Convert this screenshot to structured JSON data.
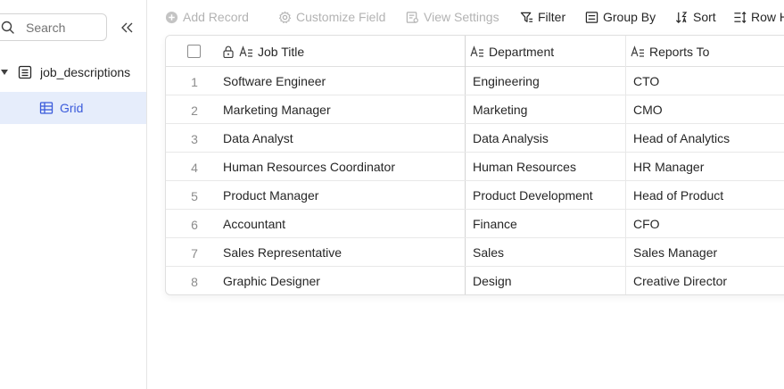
{
  "sidebar": {
    "search_placeholder": "Search",
    "table_name": "job_descriptions",
    "view_name": "Grid"
  },
  "toolbar": {
    "add_record": "Add Record",
    "customize_field": "Customize Field",
    "view_settings": "View Settings",
    "filter": "Filter",
    "group_by": "Group By",
    "sort": "Sort",
    "row_height": "Row Height"
  },
  "grid": {
    "columns": [
      "Job Title",
      "Department",
      "Reports To"
    ],
    "rows": [
      {
        "num": "1",
        "job_title": "Software Engineer",
        "department": "Engineering",
        "reports_to": "CTO"
      },
      {
        "num": "2",
        "job_title": "Marketing Manager",
        "department": "Marketing",
        "reports_to": "CMO"
      },
      {
        "num": "3",
        "job_title": "Data Analyst",
        "department": "Data Analysis",
        "reports_to": "Head of Analytics"
      },
      {
        "num": "4",
        "job_title": "Human Resources Coordinator",
        "department": "Human Resources",
        "reports_to": "HR Manager"
      },
      {
        "num": "5",
        "job_title": "Product Manager",
        "department": "Product Development",
        "reports_to": "Head of Product"
      },
      {
        "num": "6",
        "job_title": "Accountant",
        "department": "Finance",
        "reports_to": "CFO"
      },
      {
        "num": "7",
        "job_title": "Sales Representative",
        "department": "Sales",
        "reports_to": "Sales Manager"
      },
      {
        "num": "8",
        "job_title": "Graphic Designer",
        "department": "Design",
        "reports_to": "Creative Director"
      }
    ]
  },
  "colors": {
    "accent": "#3b5bdb",
    "selected_bg": "#e6edfb",
    "disabled_text": "#b3b3b3"
  },
  "icons": {
    "search": "search-icon",
    "collapse": "double-chevron-left-icon",
    "table": "table-icon",
    "grid_view": "grid-view-icon",
    "lock": "lock-icon",
    "text_field": "text-field-icon"
  }
}
